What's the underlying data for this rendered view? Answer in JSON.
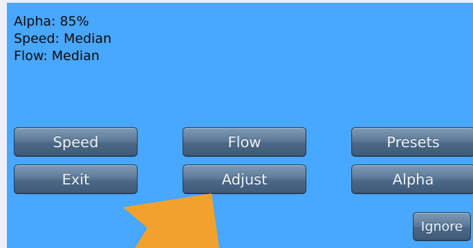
{
  "status": {
    "alpha": "Alpha: 85%",
    "speed": "Speed: Median",
    "flow": "Flow: Median"
  },
  "buttons": {
    "speed": "Speed",
    "flow": "Flow",
    "presets": "Presets",
    "exit": "Exit",
    "adjust": "Adjust",
    "alpha": "Alpha",
    "ignore": "Ignore"
  },
  "colors": {
    "dialog_background": "#48a7fe",
    "button_face": "#5d7b98",
    "pointer": "#f2a22c"
  },
  "icons": {
    "pointer": "arrow-pointer-icon"
  }
}
